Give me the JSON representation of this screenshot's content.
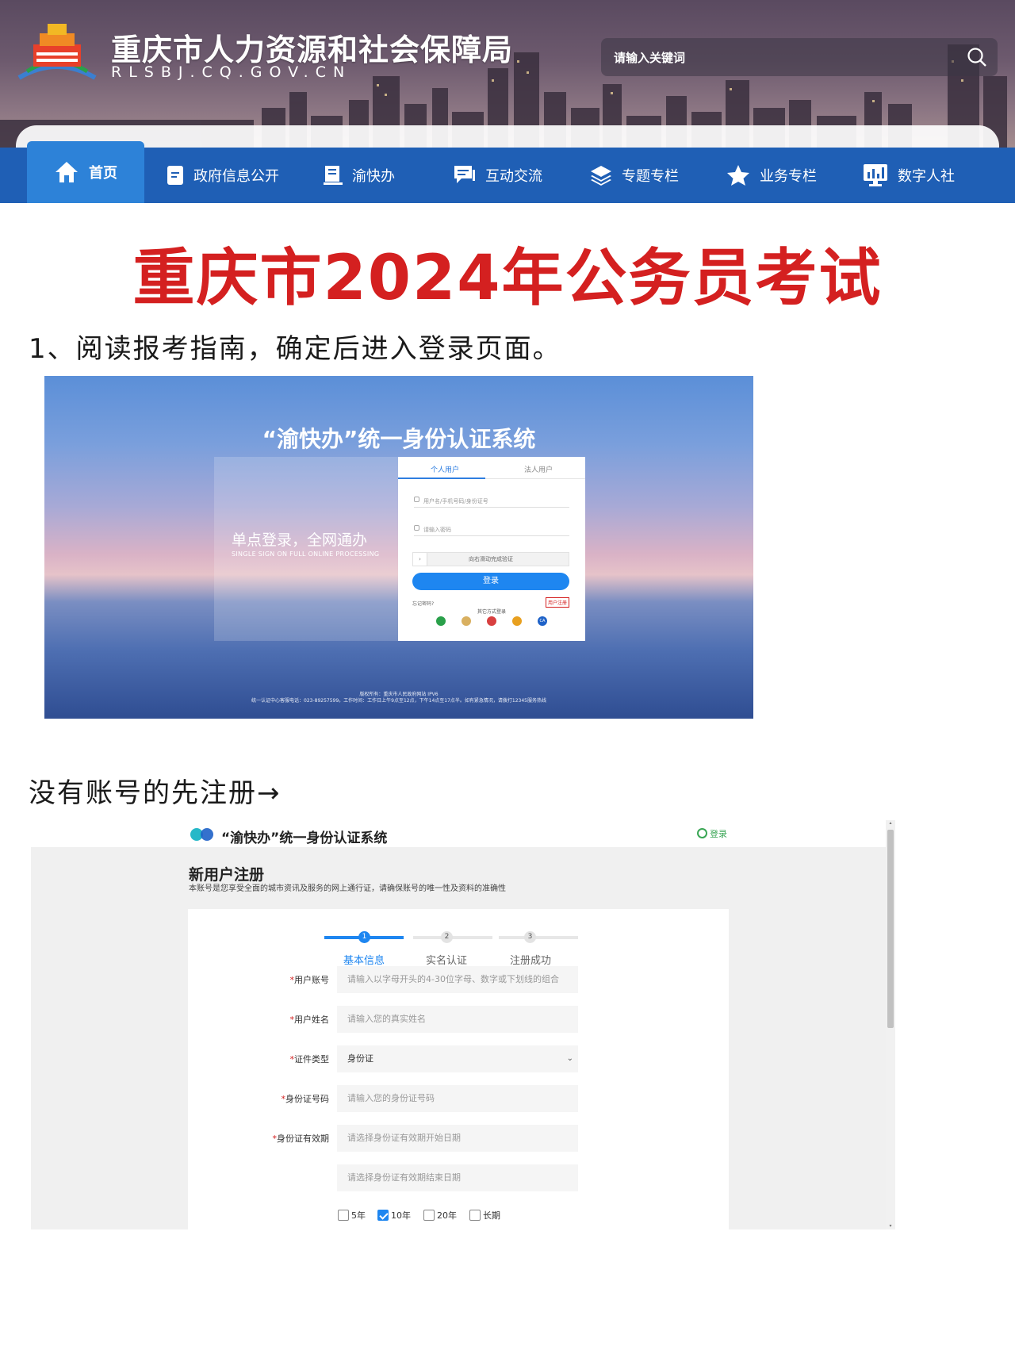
{
  "header": {
    "site_title": "重庆市人力资源和社会保障局",
    "domain": "RLSBJ.CQ.GOV.CN",
    "search_placeholder": "请输入关键词"
  },
  "nav": {
    "items": [
      {
        "label": "首页",
        "icon": "home-icon"
      },
      {
        "label": "政府信息公开",
        "icon": "document-icon"
      },
      {
        "label": "渝快办",
        "icon": "clipboard-icon"
      },
      {
        "label": "互动交流",
        "icon": "chat-icon"
      },
      {
        "label": "专题专栏",
        "icon": "layers-icon"
      },
      {
        "label": "业务专栏",
        "icon": "star-icon"
      },
      {
        "label": "数字人社",
        "icon": "monitor-icon"
      }
    ]
  },
  "headline": "重庆市2024年公务员考试",
  "step1": "1、阅读报考指南，确定后进入登录页面。",
  "step2": "没有账号的先注册→",
  "login_screen": {
    "title": "“渝快办”统一身份认证系统",
    "left_title": "单点登录，全网通办",
    "left_subtitle": "SINGLE SIGN ON FULL ONLINE PROCESSING",
    "tab_personal": "个人用户",
    "tab_legal": "法人用户",
    "username_placeholder": "用户名/手机号码/身份证号",
    "password_placeholder": "请输入密码",
    "slider_text": "向右滑动完成验证",
    "login_button": "登录",
    "forgot": "忘记密码?",
    "register": "用户注册",
    "other_login": "其它方式登录",
    "copyright": "版权所有：重庆市人民政府网站 IPV6",
    "service_line": "统一认证中心客服电话：023-89257599。工作时间：工作日上午9点至12点，下午14点至17点半。如有紧急情况，请拨打12345服务热线"
  },
  "register_screen": {
    "system_name": "“渝快办”统一身份认证系统",
    "login_link": "登录",
    "heading": "新用户注册",
    "subheading": "本账号是您享受全面的城市资讯及服务的网上通行证，请确保账号的唯一性及资料的准确性",
    "steps": [
      {
        "num": "1",
        "label": "基本信息"
      },
      {
        "num": "2",
        "label": "实名认证"
      },
      {
        "num": "3",
        "label": "注册成功"
      }
    ],
    "fields": [
      {
        "label": "用户账号",
        "value": "请输入以字母开头的4-30位字母、数字或下划线的组合"
      },
      {
        "label": "用户姓名",
        "value": "请输入您的真实姓名"
      },
      {
        "label": "证件类型",
        "value": "身份证"
      },
      {
        "label": "身份证号码",
        "value": "请输入您的身份证号码"
      },
      {
        "label": "身份证有效期",
        "value": "请选择身份证有效期开始日期"
      },
      {
        "label": "",
        "value": "请选择身份证有效期结束日期"
      }
    ],
    "validity_options": [
      "5年",
      "10年",
      "20年",
      "长期"
    ],
    "validity_selected": "10年"
  }
}
